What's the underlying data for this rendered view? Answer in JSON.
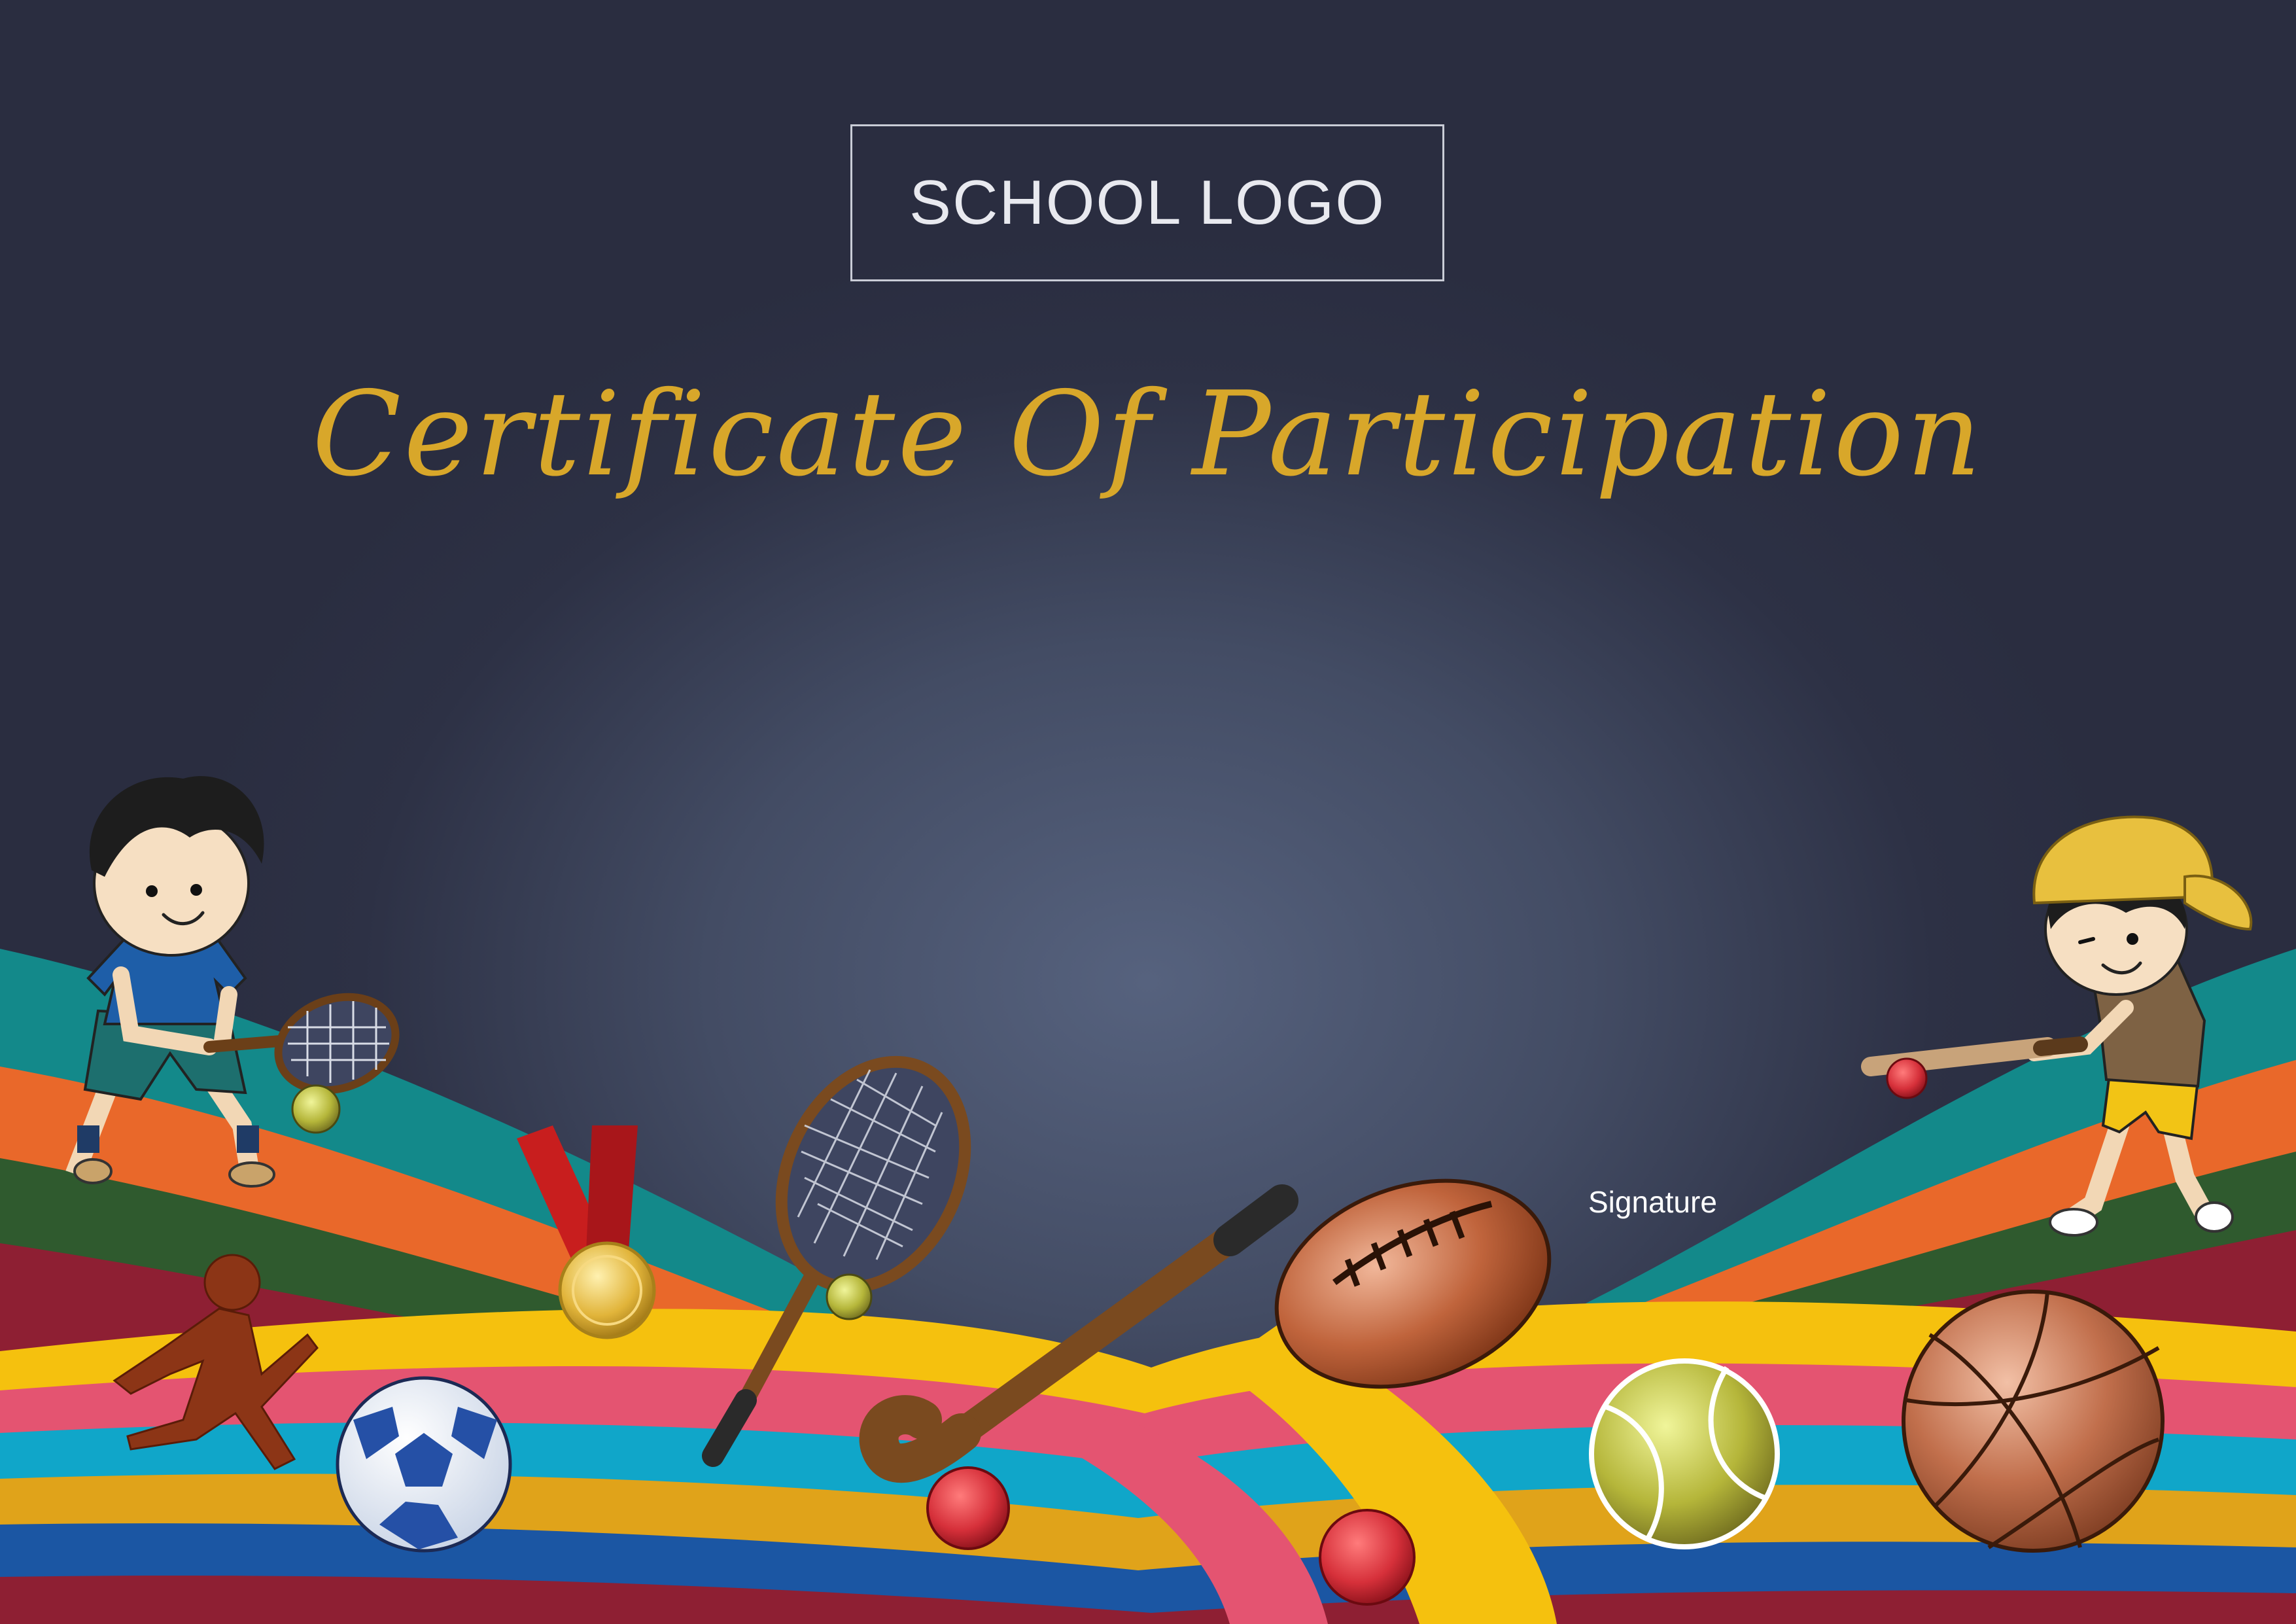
{
  "certificate": {
    "logo_label": "SCHOOL LOGO",
    "title": "Certificate Of Participation",
    "signature_label": "Signature"
  },
  "colors": {
    "background_dark": "#2b2e42",
    "title_gold": "#d8a72a",
    "stripe_teal": "#13898a",
    "stripe_orange": "#e9682a",
    "stripe_green": "#2f5a2e",
    "stripe_maroon": "#8e1f33",
    "stripe_yellow": "#f5c10e",
    "stripe_pink": "#e45471",
    "stripe_cyan": "#10a6c9",
    "stripe_blue": "#1b56a3"
  },
  "illustrations": [
    "boy-tennis-icon",
    "boy-baseball-icon",
    "runner-icon",
    "soccer-ball-icon",
    "medal-icon",
    "tennis-racket-icon",
    "hockey-stick-icon",
    "rugby-ball-icon",
    "tennis-ball-icon",
    "basketball-icon",
    "cricket-ball-icon"
  ]
}
